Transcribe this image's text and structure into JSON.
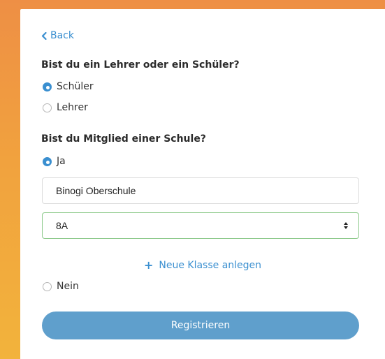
{
  "nav": {
    "back_label": "Back"
  },
  "role": {
    "question": "Bist du ein Lehrer oder ein Schüler?",
    "options": [
      {
        "label": "Schüler",
        "checked": true
      },
      {
        "label": "Lehrer",
        "checked": false
      }
    ]
  },
  "membership": {
    "question": "Bist du Mitglied einer Schule?",
    "yes_label": "Ja",
    "school_value": "Binogi Oberschule",
    "class_value": "8A",
    "add_class_label": "Neue Klasse anlegen",
    "no_label": "Nein"
  },
  "submit_label": "Registrieren",
  "colors": {
    "accent": "#3a8fd0",
    "button": "#5f9fcc",
    "valid_border": "#8cc98a",
    "background_top": "#ee8f45",
    "background_bottom": "#f2b33c"
  }
}
